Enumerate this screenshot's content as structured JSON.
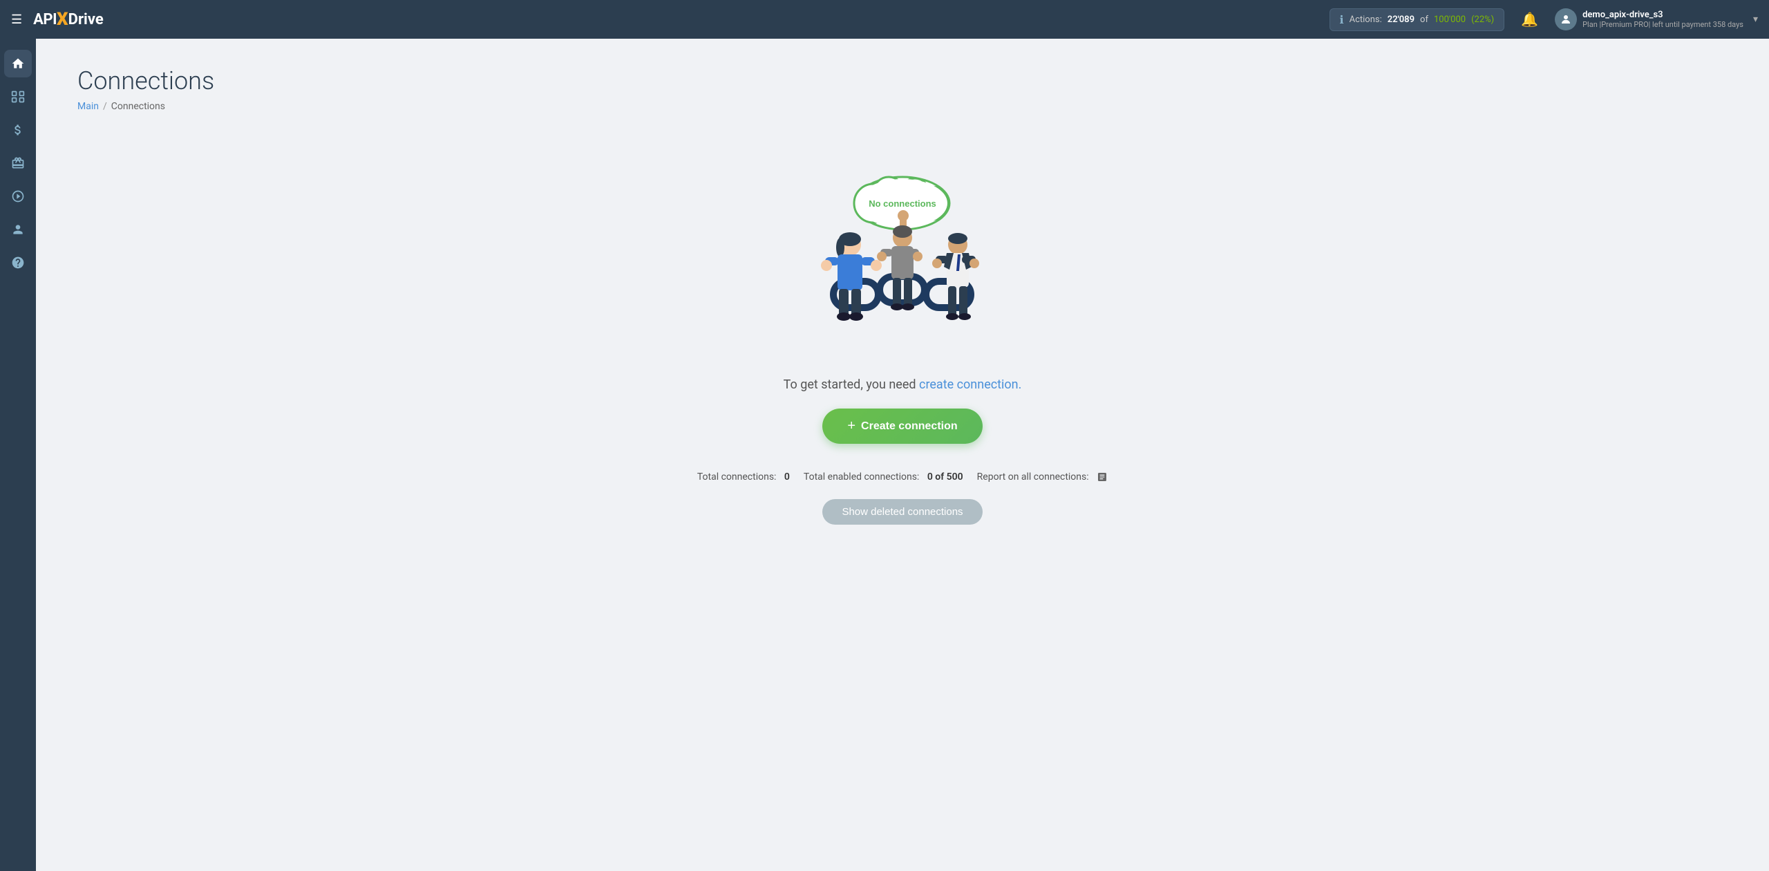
{
  "header": {
    "menu_icon": "☰",
    "logo": {
      "api": "API",
      "x": "X",
      "drive": "Drive"
    },
    "actions": {
      "label": "Actions:",
      "count": "22'089",
      "of_text": "of",
      "total": "100'000",
      "percent": "(22%)"
    },
    "bell_icon": "🔔",
    "user": {
      "name": "demo_apix-drive_s3",
      "plan_label": "Plan |Premium PRO| left until payment",
      "days": "358 days",
      "avatar_letter": "👤"
    }
  },
  "sidebar": {
    "items": [
      {
        "icon": "⌂",
        "label": "home",
        "active": true
      },
      {
        "icon": "⊞",
        "label": "connections"
      },
      {
        "icon": "$",
        "label": "billing"
      },
      {
        "icon": "💼",
        "label": "integrations"
      },
      {
        "icon": "▶",
        "label": "tutorials"
      },
      {
        "icon": "👤",
        "label": "account"
      },
      {
        "icon": "?",
        "label": "help"
      }
    ]
  },
  "page": {
    "title": "Connections",
    "breadcrumb": {
      "main_link": "Main",
      "separator": "/",
      "current": "Connections"
    },
    "empty_state": {
      "cloud_text": "No connections",
      "cta_text_before": "To get started, you need",
      "cta_link": "create connection.",
      "cta_text_after": ""
    },
    "create_button": {
      "plus": "+",
      "label": "Create connection"
    },
    "stats": {
      "total_label": "Total connections:",
      "total_value": "0",
      "enabled_label": "Total enabled connections:",
      "enabled_value": "0 of 500",
      "report_label": "Report on all connections:"
    },
    "show_deleted_button": "Show deleted connections"
  }
}
